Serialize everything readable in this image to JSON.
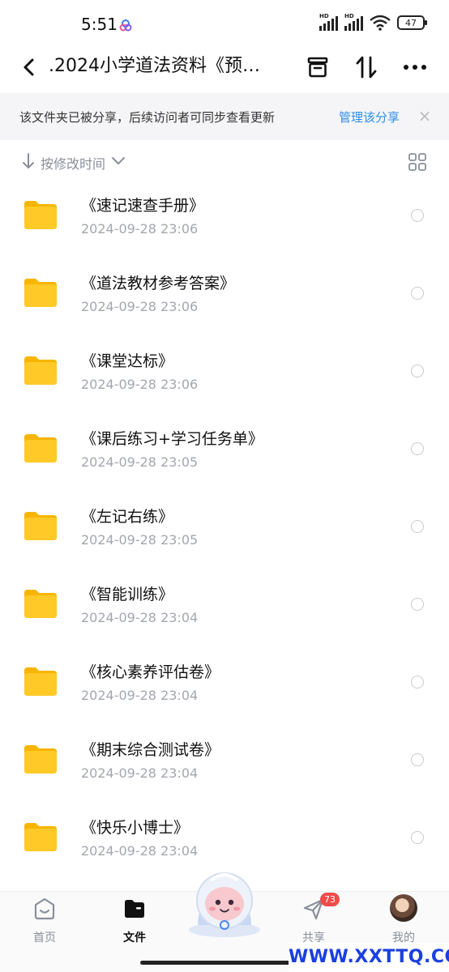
{
  "status_bar": {
    "time": "5:51",
    "battery": "47",
    "signal_badges": [
      "HD",
      "HD"
    ]
  },
  "header": {
    "title": ".2024小学道法资料《预…",
    "icons": [
      "back-icon",
      "archive-icon",
      "sort-toggle-icon",
      "more-icon"
    ]
  },
  "share_notice": {
    "text": "该文件夹已被分享，后续访问者可同步查看更新",
    "link": "管理该分享",
    "close": "×"
  },
  "sort": {
    "label": "按修改时间"
  },
  "files": [
    {
      "name": "《速记速查手册》",
      "date": "2024-09-28  23:06"
    },
    {
      "name": "《道法教材参考答案》",
      "date": "2024-09-28  23:06"
    },
    {
      "name": "《课堂达标》",
      "date": "2024-09-28  23:06"
    },
    {
      "name": "《课后练习+学习任务单》",
      "date": "2024-09-28  23:05"
    },
    {
      "name": "《左记右练》",
      "date": "2024-09-28  23:05"
    },
    {
      "name": "《智能训练》",
      "date": "2024-09-28  23:04"
    },
    {
      "name": "《核心素养评估卷》",
      "date": "2024-09-28  23:04"
    },
    {
      "name": "《期末综合测试卷》",
      "date": "2024-09-28  23:04"
    },
    {
      "name": "《快乐小博士》",
      "date": "2024-09-28  23:04"
    }
  ],
  "bottom_nav": {
    "home": "首页",
    "files": "文件",
    "share": "共享",
    "share_badge": "73",
    "me": "我的"
  },
  "watermark": "WWW.XXTTQ.COM",
  "colors": {
    "accent_link": "#2e8de9",
    "folder_yellow": "#ffc928",
    "badge_red": "#f04b4b",
    "notice_bg": "#f5f5f7"
  }
}
